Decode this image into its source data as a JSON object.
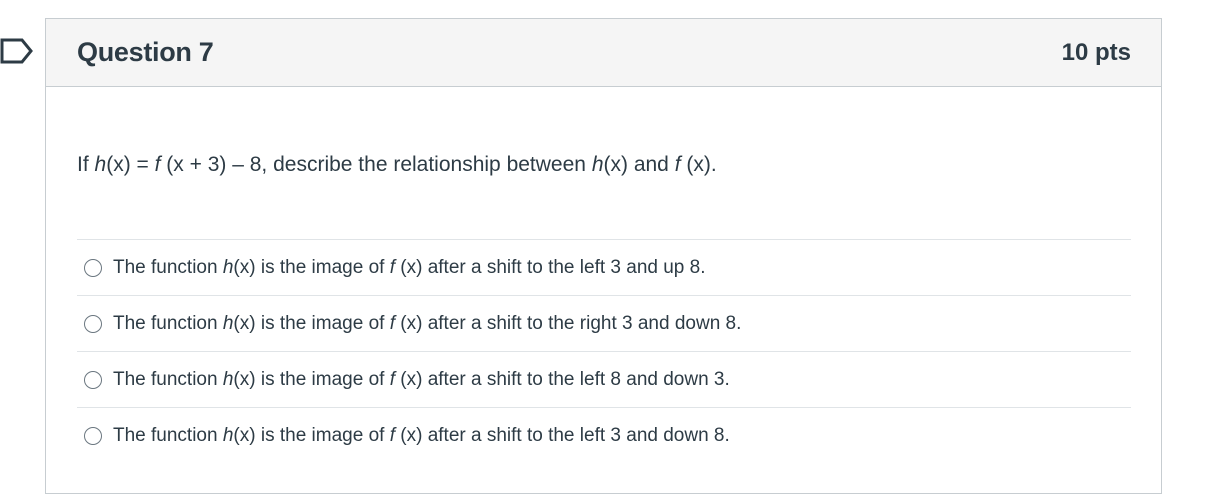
{
  "question": {
    "title": "Question 7",
    "points": "10 pts",
    "prompt": {
      "p1": "If ",
      "h1": "h",
      "p2": "(x) = ",
      "f1": "f",
      "p3": " (x + 3) – 8, describe the relationship between ",
      "h2": "h",
      "p4": "(x) and ",
      "f2": "f",
      "p5": " (x)."
    },
    "answers": [
      {
        "a": "The function ",
        "h": "h",
        "b": "(x) is the image of ",
        "f": "f",
        "c": " (x) after a shift to the left 3 and up 8."
      },
      {
        "a": "The function ",
        "h": "h",
        "b": "(x) is the image of ",
        "f": "f",
        "c": " (x) after a shift to the right 3 and down 8."
      },
      {
        "a": "The function ",
        "h": "h",
        "b": "(x) is the image of ",
        "f": "f",
        "c": " (x) after a shift to the left 8 and down 3."
      },
      {
        "a": "The function ",
        "h": "h",
        "b": "(x) is the image of ",
        "f": "f",
        "c": " (x) after a shift to the left 3 and down 8."
      }
    ]
  },
  "colors": {
    "text": "#2d3b45",
    "header_bg": "#f5f5f5",
    "border": "#c7cdd1",
    "flag": "#2d3b45"
  },
  "icons": {
    "flag": "bookmark-flag-icon",
    "radio": "radio-unselected-icon"
  }
}
